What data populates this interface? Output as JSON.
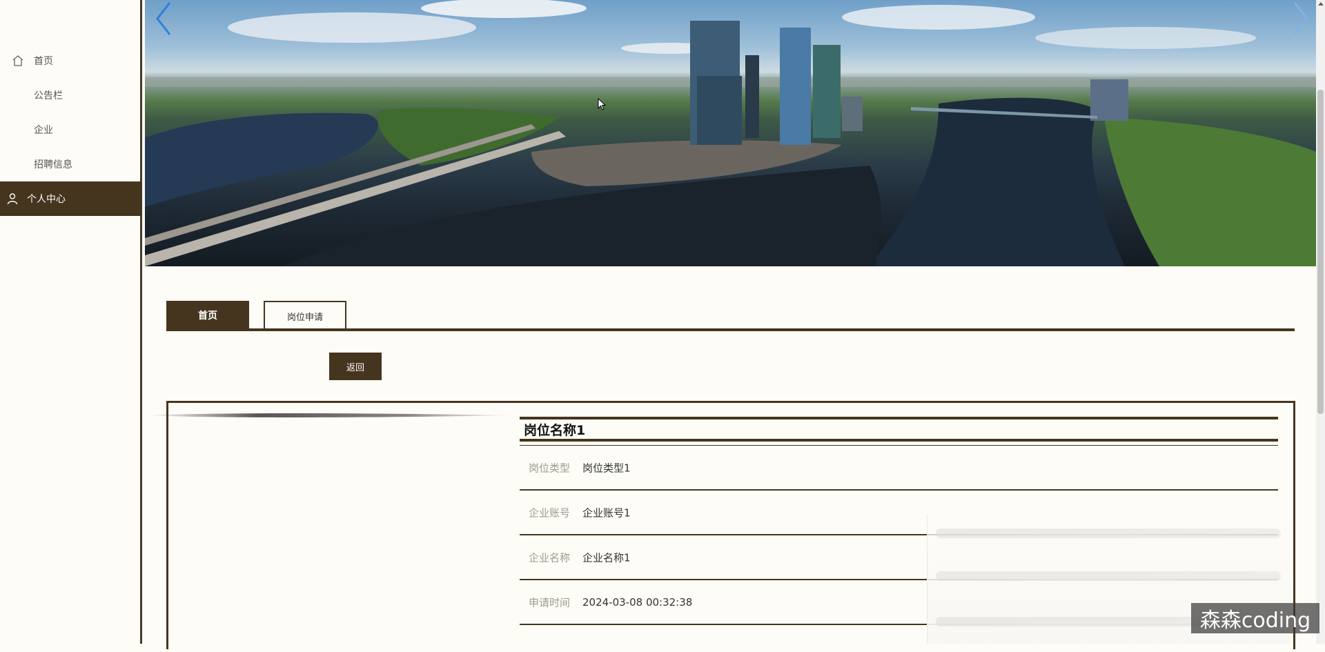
{
  "sidebar": {
    "items": [
      {
        "label": "首页",
        "icon": "home-icon"
      },
      {
        "label": "公告栏"
      },
      {
        "label": "企业"
      },
      {
        "label": "招聘信息"
      },
      {
        "label": "个人中心",
        "icon": "user-icon",
        "active": true
      }
    ]
  },
  "tabs": [
    {
      "label": "首页",
      "active": true
    },
    {
      "label": "岗位申请"
    }
  ],
  "back_button": "返回",
  "detail": {
    "title": "岗位名称1",
    "fields": [
      {
        "label": "岗位类型",
        "value": "岗位类型1"
      },
      {
        "label": "企业账号",
        "value": "企业账号1"
      },
      {
        "label": "企业名称",
        "value": "企业名称1"
      },
      {
        "label": "申请时间",
        "value": "2024-03-08 00:32:38"
      }
    ]
  },
  "watermark": "森森coding",
  "colors": {
    "accent": "#45351f",
    "background": "#fdfcf7",
    "arrow": "#2f7fd8"
  }
}
